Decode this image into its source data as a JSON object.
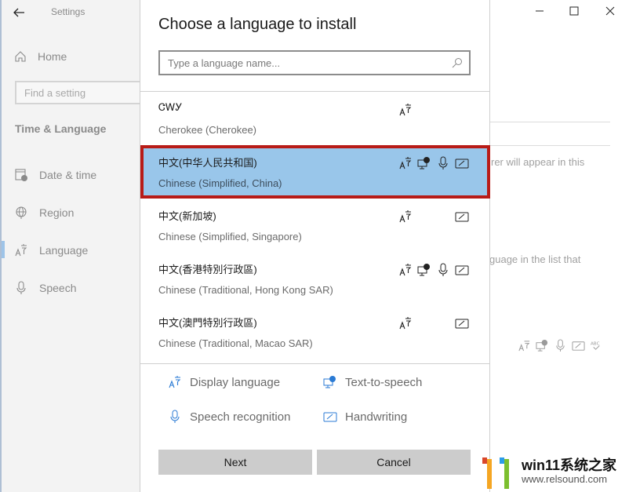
{
  "settings": {
    "app_title": "Settings",
    "home_label": "Home",
    "find_placeholder": "Find a setting",
    "section_title": "Time & Language",
    "nav": [
      {
        "label": "Date & time",
        "icon": "calendar-clock-icon"
      },
      {
        "label": "Region",
        "icon": "globe-icon"
      },
      {
        "label": "Language",
        "icon": "language-icon",
        "active": true
      },
      {
        "label": "Speech",
        "icon": "microphone-icon"
      }
    ],
    "background_text_1": "rer will appear in this",
    "background_text_2": "guage in the list that"
  },
  "dialog": {
    "title": "Choose a language to install",
    "search_placeholder": "Type a language name...",
    "search_value": "",
    "languages": [
      {
        "native": "ᏣᎳᎩ",
        "english": "Cherokee (Cherokee)",
        "features": [
          "display"
        ],
        "selected": false
      },
      {
        "native": "中文(中华人民共和国)",
        "english": "Chinese (Simplified, China)",
        "features": [
          "display",
          "tts",
          "speech",
          "handwriting"
        ],
        "selected": true
      },
      {
        "native": "中文(新加坡)",
        "english": "Chinese (Simplified, Singapore)",
        "features": [
          "display",
          "handwriting"
        ],
        "selected": false
      },
      {
        "native": "中文(香港特別行政區)",
        "english": "Chinese (Traditional, Hong Kong SAR)",
        "features": [
          "display",
          "tts",
          "speech",
          "handwriting"
        ],
        "selected": false
      },
      {
        "native": "中文(澳門特別行政區)",
        "english": "Chinese (Traditional, Macao SAR)",
        "features": [
          "display",
          "handwriting"
        ],
        "selected": false
      }
    ],
    "legend": {
      "display": "Display language",
      "tts": "Text-to-speech",
      "speech": "Speech recognition",
      "handwriting": "Handwriting"
    },
    "next_label": "Next",
    "cancel_label": "Cancel"
  },
  "watermark": {
    "title": "win11系统之家",
    "url": "www.relsound.com"
  },
  "colors": {
    "selection_bg": "#99c6ea",
    "highlight_border": "#b81b17",
    "legend_icon": "#2a7ad4"
  }
}
